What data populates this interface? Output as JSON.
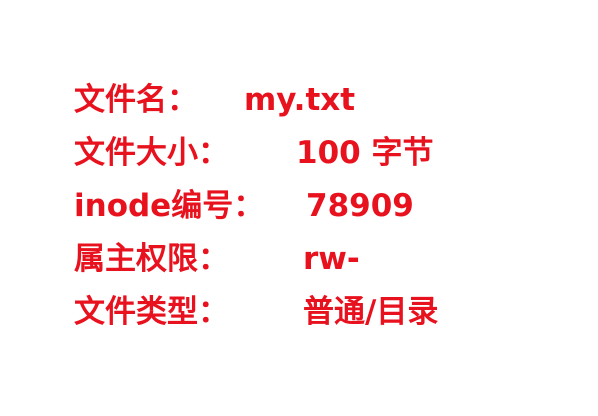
{
  "file_info": {
    "rows": [
      {
        "label": "文件名：",
        "value": "my.txt"
      },
      {
        "label": "文件大小：",
        "value": "100 字节"
      },
      {
        "label": "inode编号：",
        "value": "78909"
      },
      {
        "label": "属主权限：",
        "value": "rw-"
      },
      {
        "label": "文件类型：",
        "value": "普通/目录"
      }
    ]
  },
  "colors": {
    "text": "#e8121f",
    "background": "#ffffff"
  }
}
